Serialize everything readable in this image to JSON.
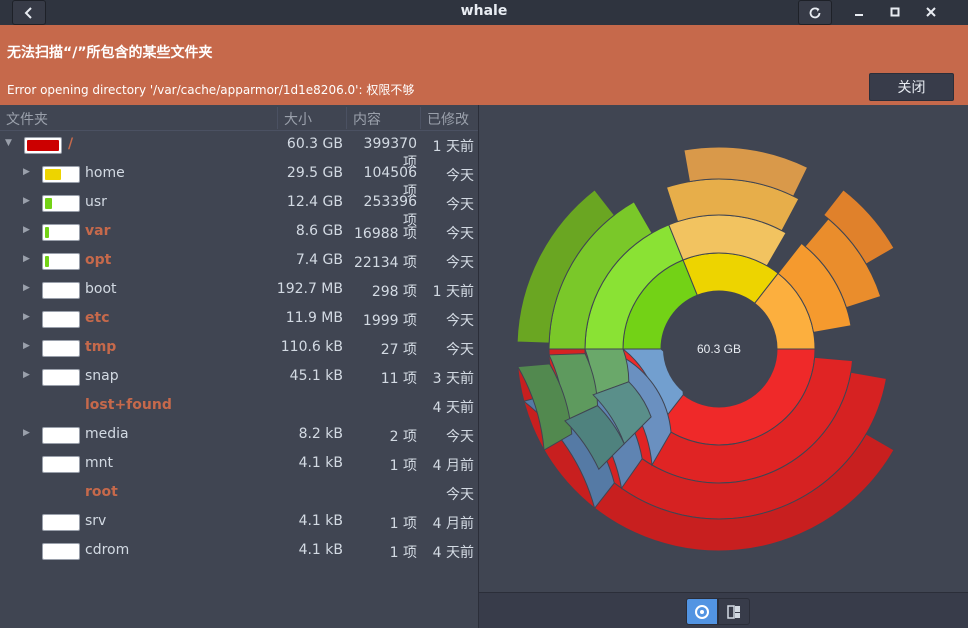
{
  "window": {
    "title": "whale"
  },
  "banner": {
    "title": "无法扫描“/”所包含的某些文件夹",
    "message": "Error opening directory '/var/cache/apparmor/1d1e8206.0': 权限不够",
    "close_label": "关闭"
  },
  "tree": {
    "headers": {
      "folder": "文件夹",
      "size": "大小",
      "contents": "内容",
      "modified": "已修改"
    },
    "rows": [
      {
        "name": "/",
        "size": "60.3 GB",
        "count": "399370 项",
        "date": "1 天前",
        "fill": 1.0,
        "fill_color": "#cc0000",
        "error": true,
        "expander": "down",
        "level": 0
      },
      {
        "name": "home",
        "size": "29.5 GB",
        "count": "104506 项",
        "date": "今天",
        "fill": 0.49,
        "fill_color": "#edd400",
        "error": false,
        "expander": "right",
        "level": 1
      },
      {
        "name": "usr",
        "size": "12.4 GB",
        "count": "253396 项",
        "date": "今天",
        "fill": 0.21,
        "fill_color": "#73d216",
        "error": false,
        "expander": "right",
        "level": 1
      },
      {
        "name": "var",
        "size": "8.6 GB",
        "count": "16988 项",
        "date": "今天",
        "fill": 0.14,
        "fill_color": "#73d216",
        "error": true,
        "expander": "right",
        "level": 1
      },
      {
        "name": "opt",
        "size": "7.4 GB",
        "count": "22134 项",
        "date": "今天",
        "fill": 0.12,
        "fill_color": "#73d216",
        "error": true,
        "expander": "right",
        "level": 1
      },
      {
        "name": "boot",
        "size": "192.7 MB",
        "count": "298 项",
        "date": "1 天前",
        "fill": 0.0,
        "fill_color": "#73d216",
        "error": false,
        "expander": "right",
        "level": 1
      },
      {
        "name": "etc",
        "size": "11.9 MB",
        "count": "1999 项",
        "date": "今天",
        "fill": 0.0,
        "fill_color": "#73d216",
        "error": true,
        "expander": "right",
        "level": 1
      },
      {
        "name": "tmp",
        "size": "110.6 kB",
        "count": "27 项",
        "date": "今天",
        "fill": 0.0,
        "fill_color": "#73d216",
        "error": true,
        "expander": "right",
        "level": 1
      },
      {
        "name": "snap",
        "size": "45.1 kB",
        "count": "11 项",
        "date": "3 天前",
        "fill": 0.0,
        "fill_color": "#73d216",
        "error": false,
        "expander": "right",
        "level": 1
      },
      {
        "name": "lost+found",
        "size": "",
        "count": "",
        "date": "4 天前",
        "fill": null,
        "fill_color": "",
        "error": true,
        "expander": "none",
        "level": 1
      },
      {
        "name": "media",
        "size": "8.2 kB",
        "count": "2 项",
        "date": "今天",
        "fill": 0.0,
        "fill_color": "#73d216",
        "error": false,
        "expander": "right",
        "level": 1
      },
      {
        "name": "mnt",
        "size": "4.1 kB",
        "count": "1 项",
        "date": "4 月前",
        "fill": 0.0,
        "fill_color": "#73d216",
        "error": false,
        "expander": "none",
        "level": 1
      },
      {
        "name": "root",
        "size": "",
        "count": "",
        "date": "今天",
        "fill": null,
        "fill_color": "",
        "error": true,
        "expander": "none",
        "level": 1
      },
      {
        "name": "srv",
        "size": "4.1 kB",
        "count": "1 项",
        "date": "4 月前",
        "fill": 0.0,
        "fill_color": "#73d216",
        "error": false,
        "expander": "none",
        "level": 1
      },
      {
        "name": "cdrom",
        "size": "4.1 kB",
        "count": "1 项",
        "date": "4 天前",
        "fill": 0.0,
        "fill_color": "#73d216",
        "error": false,
        "expander": "none",
        "level": 1
      }
    ]
  },
  "chart": {
    "center_label": "60.3 GB"
  },
  "colors": {
    "accent": "#5294e2",
    "error": "#c6694b",
    "banner": "#c6694b"
  }
}
